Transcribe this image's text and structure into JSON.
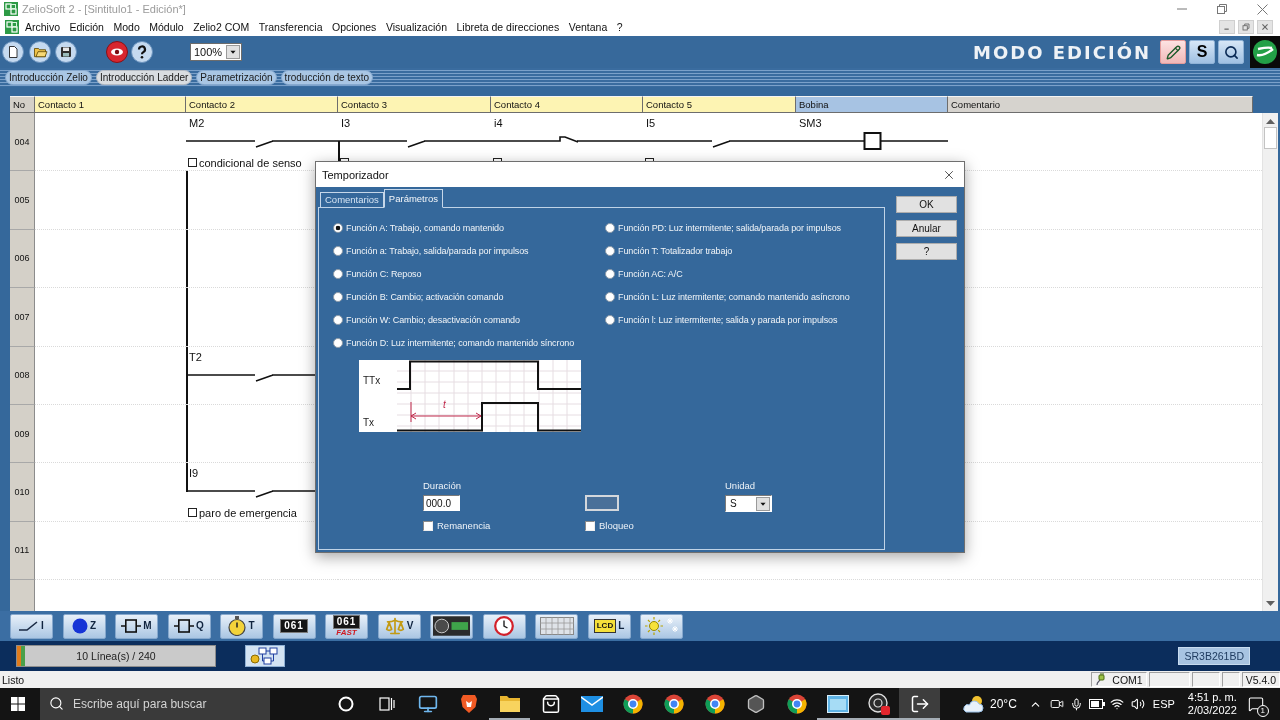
{
  "window": {
    "title": "ZelioSoft 2 - [Sintitulo1 - Edición*]",
    "active": false
  },
  "menu": [
    "Archivo",
    "Edición",
    "Modo",
    "Módulo",
    "Zelio2 COM",
    "Transferencia",
    "Opciones",
    "Visualización",
    "Libreta de direcciones",
    "Ventana",
    "?"
  ],
  "toolbar": {
    "zoom": "100%",
    "mode_title": "MODO EDICIÓN",
    "mode_buttons": [
      {
        "kind": "edit",
        "selected": true
      },
      {
        "kind": "simulation",
        "label": "S",
        "selected": false
      },
      {
        "kind": "monitor",
        "selected": false
      }
    ]
  },
  "view_tabs": [
    {
      "label": "Introducción Zelio",
      "selected": false
    },
    {
      "label": "Introducción Ladder",
      "selected": true
    },
    {
      "label": "Parametrización",
      "selected": false
    },
    {
      "label": "troducción de texto",
      "selected": false
    }
  ],
  "ladder": {
    "columns": [
      {
        "label": "No",
        "kind": "number"
      },
      {
        "label": "Contacto 1",
        "kind": "contact"
      },
      {
        "label": "Contacto 2",
        "kind": "contact"
      },
      {
        "label": "Contacto 3",
        "kind": "contact"
      },
      {
        "label": "Contacto 4",
        "kind": "contact"
      },
      {
        "label": "Contacto 5",
        "kind": "contact"
      },
      {
        "label": "Bobina",
        "kind": "coil"
      },
      {
        "label": "Comentario",
        "kind": "comment"
      }
    ],
    "rows": [
      {
        "number": "004",
        "cells": [
          null,
          {
            "kind": "open",
            "label": "M2",
            "marker": true,
            "comment": "condicional de senso"
          },
          {
            "kind": "open",
            "label": "I3",
            "marker": true,
            "link_down": true
          },
          {
            "kind": "closed",
            "label": "i4",
            "marker": true
          },
          {
            "kind": "open",
            "label": "I5",
            "marker": true
          },
          {
            "kind": "coil",
            "label": "SM3"
          }
        ]
      },
      {
        "number": "005",
        "cells": [
          null,
          {
            "link_up": true,
            "link_down": true
          }
        ]
      },
      {
        "number": "006",
        "cells": [
          null,
          {
            "link_up": true,
            "link_down": true
          }
        ]
      },
      {
        "number": "007",
        "cells": [
          null,
          {
            "link_up": true,
            "link_down": true
          }
        ]
      },
      {
        "number": "008",
        "cells": [
          null,
          {
            "kind": "open",
            "label": "T2",
            "link_up": true,
            "link_down": true
          }
        ]
      },
      {
        "number": "009",
        "cells": [
          null,
          {
            "link_up": true,
            "link_down": true
          }
        ]
      },
      {
        "number": "010",
        "cells": [
          null,
          {
            "kind": "open",
            "label": "I9",
            "marker": true,
            "comment": "paro de emergencia",
            "link_up": true
          }
        ]
      },
      {
        "number": "011"
      }
    ]
  },
  "timer_dialog": {
    "title": "Temporizador",
    "tabs": [
      {
        "label": "Comentarios",
        "selected": false
      },
      {
        "label": "Parámetros",
        "selected": true
      }
    ],
    "function_columns": [
      [
        {
          "label": "Función A: Trabajo, comando mantenido",
          "selected": true
        },
        {
          "label": "Función a: Trabajo, salida/parada por impulsos",
          "selected": false
        },
        {
          "label": "Función C: Reposo",
          "selected": false
        },
        {
          "label": "Función B: Cambio; activación comando",
          "selected": false
        },
        {
          "label": "Función W: Cambio; desactivación comando",
          "selected": false
        },
        {
          "label": "Función D: Luz intermitente; comando mantenido síncrono",
          "selected": false
        }
      ],
      [
        {
          "label": "Función PD: Luz intermitente; salida/parada por impulsos",
          "selected": false
        },
        {
          "label": "Función T: Totalizador trabajo",
          "selected": false
        },
        {
          "label": "Función AC: A/C",
          "selected": false
        },
        {
          "label": "Función L: Luz intermitente; comando mantenido asíncrono",
          "selected": false
        },
        {
          "label": "Función l: Luz intermitente; salida y parada por impulsos",
          "selected": false
        }
      ]
    ],
    "timing_diagram": {
      "signals": [
        "TTx",
        "Tx"
      ],
      "interval": "t"
    },
    "duration": {
      "label": "Duración",
      "value": "000.0"
    },
    "secondary_field": {
      "disabled": true
    },
    "unit": {
      "label": "Unidad",
      "value": "S"
    },
    "checkboxes": [
      {
        "label": "Remanencia",
        "checked": false
      },
      {
        "label": "Bloqueo",
        "checked": false
      }
    ],
    "buttons": [
      "OK",
      "Anular",
      "?"
    ]
  },
  "palette": [
    {
      "kind": "contact",
      "label": "I"
    },
    {
      "kind": "bit",
      "label": "Z"
    },
    {
      "kind": "relay",
      "label": "M"
    },
    {
      "kind": "output",
      "label": "Q"
    },
    {
      "kind": "timer",
      "label": "T"
    },
    {
      "kind": "counter",
      "display": "061"
    },
    {
      "kind": "fast",
      "display": "061",
      "caption": "FAST"
    },
    {
      "kind": "compare",
      "label": "V"
    },
    {
      "kind": "analog"
    },
    {
      "kind": "clock"
    },
    {
      "kind": "text"
    },
    {
      "kind": "lcd",
      "display": "LCD",
      "label": "L"
    },
    {
      "kind": "backlight"
    }
  ],
  "status_panel": {
    "lines": "10 Línea(s) / 240",
    "level": 0.04,
    "module": "SR3B261BD"
  },
  "status_bar": {
    "message": "Listo",
    "port": "COM1",
    "version": "V5.4.0"
  },
  "taskbar": {
    "search_placeholder": "Escribe aquí para buscar",
    "apps": [
      {
        "kind": "assistant",
        "selected": false,
        "running": false
      },
      {
        "kind": "taskview",
        "selected": false,
        "running": false
      },
      {
        "kind": "desktop",
        "selected": false,
        "running": false
      },
      {
        "kind": "shield",
        "selected": false,
        "running": false
      },
      {
        "kind": "folder",
        "selected": false,
        "running": true
      },
      {
        "kind": "store",
        "selected": false,
        "running": false
      },
      {
        "kind": "mail",
        "selected": false,
        "running": false
      },
      {
        "kind": "browser",
        "selected": false,
        "running": false
      },
      {
        "kind": "browser",
        "selected": false,
        "running": false
      },
      {
        "kind": "browser",
        "selected": false,
        "running": false
      },
      {
        "kind": "hexagon",
        "selected": false,
        "running": false
      },
      {
        "kind": "browser",
        "selected": false,
        "running": false
      },
      {
        "kind": "viewer",
        "selected": false,
        "running": true
      },
      {
        "kind": "recorder",
        "selected": false,
        "running": true
      },
      {
        "kind": "switch",
        "selected": true,
        "running": true
      }
    ],
    "temperature": "20°C",
    "language": "ESP",
    "time": "4:51 p. m.",
    "date": "2/03/2022",
    "notifications": "1"
  }
}
